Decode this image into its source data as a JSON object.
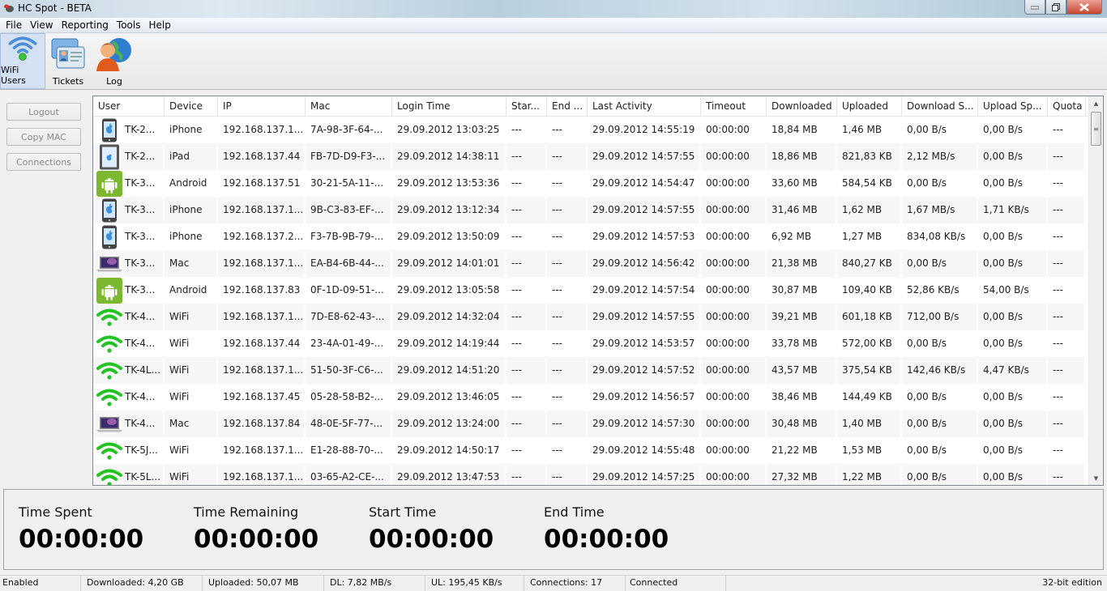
{
  "window": {
    "title": "HC Spot - BETA"
  },
  "menu": [
    "File",
    "View",
    "Reporting",
    "Tools",
    "Help"
  ],
  "toolbar": {
    "buttons": [
      {
        "label": "WiFi Users",
        "icon": "wifi-users-icon",
        "active": true
      },
      {
        "label": "Tickets",
        "icon": "tickets-icon",
        "active": false
      },
      {
        "label": "Log",
        "icon": "log-icon",
        "active": false
      }
    ]
  },
  "side_buttons": {
    "logout": "Logout",
    "copy_mac": "Copy MAC",
    "connections": "Connections"
  },
  "table": {
    "columns": [
      "User",
      "Device",
      "IP",
      "Mac",
      "Login Time",
      "Star...",
      "End ...",
      "Last Activity",
      "Timeout",
      "Downloaded",
      "Uploaded",
      "Download S...",
      "Upload Sp...",
      "Quota"
    ],
    "rows": [
      {
        "icon": "iphone",
        "user": "TK-2...",
        "device": "iPhone",
        "ip": "192.168.137.1...",
        "mac": "7A-98-3F-64-...",
        "login": "29.09.2012 13:03:25",
        "start": "---",
        "end": "---",
        "last": "29.09.2012 14:55:19",
        "timeout": "00:00:00",
        "dl": "18,84 MB",
        "ul": "1,46 MB",
        "dls": "0,00 B/s",
        "uls": "0,00 B/s",
        "quota": "---"
      },
      {
        "icon": "ipad",
        "user": "TK-2...",
        "device": "iPad",
        "ip": "192.168.137.44",
        "mac": "FB-7D-D9-F3-...",
        "login": "29.09.2012 14:38:11",
        "start": "---",
        "end": "---",
        "last": "29.09.2012 14:57:55",
        "timeout": "00:00:00",
        "dl": "18,86 MB",
        "ul": "821,83 KB",
        "dls": "2,12 MB/s",
        "uls": "0,00 B/s",
        "quota": "---"
      },
      {
        "icon": "android",
        "user": "TK-3...",
        "device": "Android",
        "ip": "192.168.137.51",
        "mac": "30-21-5A-11-...",
        "login": "29.09.2012 13:53:36",
        "start": "---",
        "end": "---",
        "last": "29.09.2012 14:54:47",
        "timeout": "00:00:00",
        "dl": "33,60 MB",
        "ul": "584,54 KB",
        "dls": "0,00 B/s",
        "uls": "0,00 B/s",
        "quota": "---"
      },
      {
        "icon": "iphone",
        "user": "TK-3...",
        "device": "iPhone",
        "ip": "192.168.137.1...",
        "mac": "9B-C3-83-EF-...",
        "login": "29.09.2012 13:12:34",
        "start": "---",
        "end": "---",
        "last": "29.09.2012 14:57:55",
        "timeout": "00:00:00",
        "dl": "31,46 MB",
        "ul": "1,62 MB",
        "dls": "1,67 MB/s",
        "uls": "1,71 KB/s",
        "quota": "---"
      },
      {
        "icon": "iphone",
        "user": "TK-3...",
        "device": "iPhone",
        "ip": "192.168.137.2...",
        "mac": "F3-7B-9B-79-...",
        "login": "29.09.2012 13:50:09",
        "start": "---",
        "end": "---",
        "last": "29.09.2012 14:57:53",
        "timeout": "00:00:00",
        "dl": "6,92 MB",
        "ul": "1,27 MB",
        "dls": "834,08 KB/s",
        "uls": "0,00 B/s",
        "quota": "---"
      },
      {
        "icon": "mac",
        "user": "TK-3...",
        "device": "Mac",
        "ip": "192.168.137.1...",
        "mac": "EA-B4-6B-44-...",
        "login": "29.09.2012 14:01:01",
        "start": "---",
        "end": "---",
        "last": "29.09.2012 14:56:42",
        "timeout": "00:00:00",
        "dl": "21,38 MB",
        "ul": "840,27 KB",
        "dls": "0,00 B/s",
        "uls": "0,00 B/s",
        "quota": "---"
      },
      {
        "icon": "android",
        "user": "TK-3...",
        "device": "Android",
        "ip": "192.168.137.83",
        "mac": "0F-1D-09-51-...",
        "login": "29.09.2012 13:05:58",
        "start": "---",
        "end": "---",
        "last": "29.09.2012 14:57:54",
        "timeout": "00:00:00",
        "dl": "30,87 MB",
        "ul": "109,40 KB",
        "dls": "52,86 KB/s",
        "uls": "54,00 B/s",
        "quota": "---"
      },
      {
        "icon": "wifi",
        "user": "TK-4...",
        "device": "WiFi",
        "ip": "192.168.137.1...",
        "mac": "7D-E8-62-43-...",
        "login": "29.09.2012 14:32:04",
        "start": "---",
        "end": "---",
        "last": "29.09.2012 14:57:55",
        "timeout": "00:00:00",
        "dl": "39,21 MB",
        "ul": "601,18 KB",
        "dls": "712,00 B/s",
        "uls": "0,00 B/s",
        "quota": "---"
      },
      {
        "icon": "wifi",
        "user": "TK-4...",
        "device": "WiFi",
        "ip": "192.168.137.44",
        "mac": "23-4A-01-49-...",
        "login": "29.09.2012 14:19:44",
        "start": "---",
        "end": "---",
        "last": "29.09.2012 14:53:57",
        "timeout": "00:00:00",
        "dl": "33,78 MB",
        "ul": "572,00 KB",
        "dls": "0,00 B/s",
        "uls": "0,00 B/s",
        "quota": "---"
      },
      {
        "icon": "wifi",
        "user": "TK-4L...",
        "device": "WiFi",
        "ip": "192.168.137.1...",
        "mac": "51-50-3F-C6-...",
        "login": "29.09.2012 14:51:20",
        "start": "---",
        "end": "---",
        "last": "29.09.2012 14:57:52",
        "timeout": "00:00:00",
        "dl": "43,57 MB",
        "ul": "375,54 KB",
        "dls": "142,46 KB/s",
        "uls": "4,47 KB/s",
        "quota": "---"
      },
      {
        "icon": "wifi",
        "user": "TK-4...",
        "device": "WiFi",
        "ip": "192.168.137.45",
        "mac": "05-28-58-B2-...",
        "login": "29.09.2012 13:46:05",
        "start": "---",
        "end": "---",
        "last": "29.09.2012 14:56:57",
        "timeout": "00:00:00",
        "dl": "38,46 MB",
        "ul": "144,49 KB",
        "dls": "0,00 B/s",
        "uls": "0,00 B/s",
        "quota": "---"
      },
      {
        "icon": "mac",
        "user": "TK-4...",
        "device": "Mac",
        "ip": "192.168.137.84",
        "mac": "48-0E-5F-77-...",
        "login": "29.09.2012 13:24:00",
        "start": "---",
        "end": "---",
        "last": "29.09.2012 14:57:30",
        "timeout": "00:00:00",
        "dl": "30,48 MB",
        "ul": "1,40 MB",
        "dls": "0,00 B/s",
        "uls": "0,00 B/s",
        "quota": "---"
      },
      {
        "icon": "wifi",
        "user": "TK-5J...",
        "device": "WiFi",
        "ip": "192.168.137.1...",
        "mac": "E1-28-88-70-...",
        "login": "29.09.2012 14:50:17",
        "start": "---",
        "end": "---",
        "last": "29.09.2012 14:55:48",
        "timeout": "00:00:00",
        "dl": "21,22 MB",
        "ul": "1,53 MB",
        "dls": "0,00 B/s",
        "uls": "0,00 B/s",
        "quota": "---"
      },
      {
        "icon": "wifi",
        "user": "TK-5L...",
        "device": "WiFi",
        "ip": "192.168.137.1...",
        "mac": "03-65-A2-CE-...",
        "login": "29.09.2012 13:47:53",
        "start": "---",
        "end": "---",
        "last": "29.09.2012 14:57:25",
        "timeout": "00:00:00",
        "dl": "27,32 MB",
        "ul": "1,22 MB",
        "dls": "0,00 B/s",
        "uls": "0,00 B/s",
        "quota": "---"
      }
    ]
  },
  "timers": [
    {
      "label": "Time Spent",
      "value": "00:00:00"
    },
    {
      "label": "Time Remaining",
      "value": "00:00:00"
    },
    {
      "label": "Start Time",
      "value": "00:00:00"
    },
    {
      "label": "End Time",
      "value": "00:00:00"
    }
  ],
  "statusbar": {
    "state": "Enabled",
    "downloaded": "Downloaded: 4,20 GB",
    "uploaded": "Uploaded: 50,07 MB",
    "dl_speed": "DL: 7,82 MB/s",
    "ul_speed": "UL: 195,45 KB/s",
    "connections": "Connections: 17",
    "connection_state": "Connected",
    "edition": "32-bit edition"
  },
  "colors": {
    "android_green": "#7cb82f",
    "wifi_green": "#22c322",
    "apple_blue": "#3a8fde",
    "close_red": "#c7462f"
  }
}
